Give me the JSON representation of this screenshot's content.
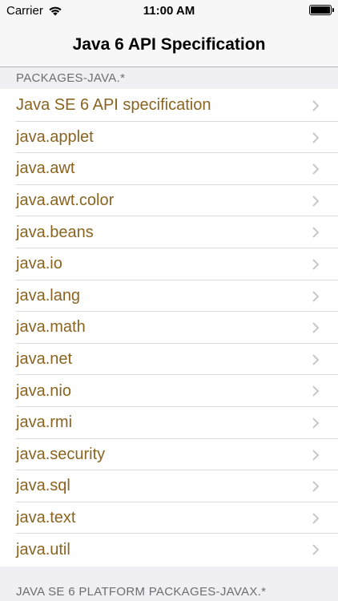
{
  "status_bar": {
    "carrier": "Carrier",
    "time": "11:00 AM",
    "battery_level": 1.0
  },
  "nav": {
    "title": "Java 6 API Specification"
  },
  "sections": [
    {
      "header": "PACKAGES-JAVA.*",
      "items": [
        "Java SE 6 API specification",
        "java.applet",
        "java.awt",
        "java.awt.color",
        "java.beans",
        "java.io",
        "java.lang",
        "java.math",
        "java.net",
        "java.nio",
        "java.rmi",
        "java.security",
        "java.sql",
        "java.text",
        "java.util"
      ]
    },
    {
      "header": "JAVA SE 6 PLATFORM PACKAGES-JAVAX.*",
      "items": []
    }
  ],
  "colors": {
    "item_text": "#8a6420",
    "header_text": "#6d6d72",
    "header_bg": "#efeff4"
  },
  "icons": {
    "wifi": "wifi-icon",
    "battery": "battery-icon",
    "chevron": "chevron-right-icon"
  }
}
